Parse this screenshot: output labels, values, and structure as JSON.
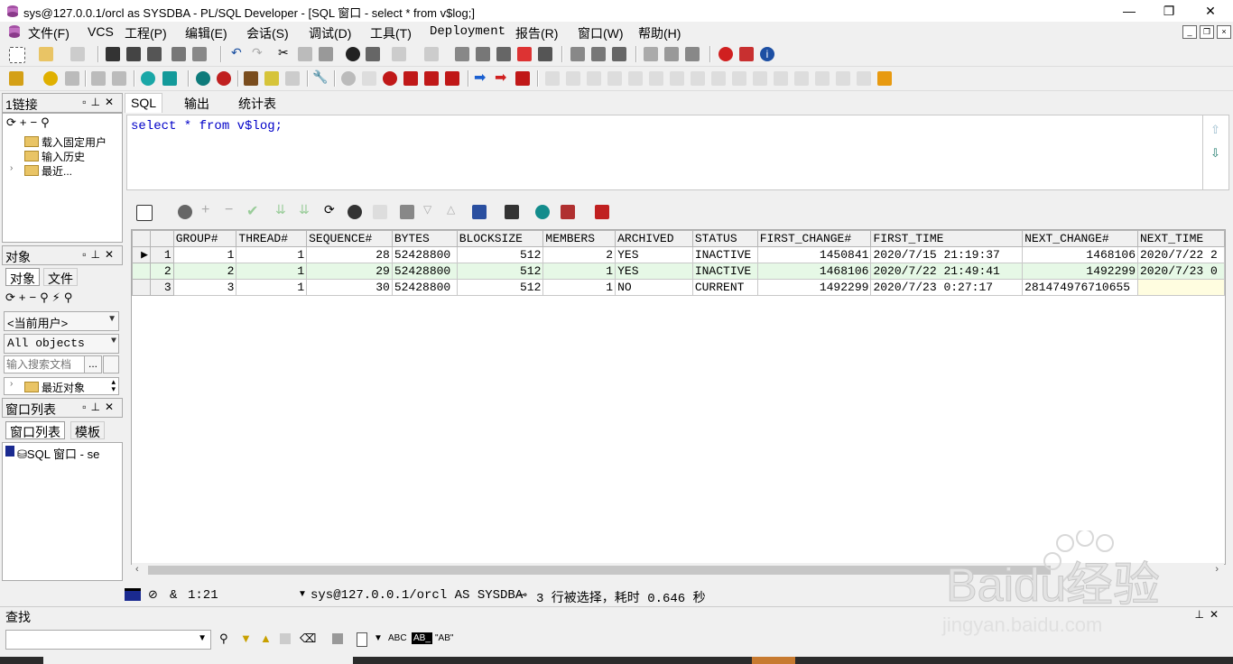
{
  "window": {
    "title": "sys@127.0.0.1/orcl as SYSDBA - PL/SQL Developer - [SQL 窗口 - select * from v$log;]",
    "min": "—",
    "max": "❐",
    "close": "✕"
  },
  "menu": [
    "文件(F)",
    "VCS",
    "工程(P)",
    "编辑(E)",
    "会话(S)",
    "调试(D)",
    "工具(T)",
    "Deployment",
    "报告(R)",
    "窗口(W)",
    "帮助(H)"
  ],
  "left": {
    "connections": {
      "title": "1链接",
      "items": [
        "载入固定用户",
        "输入历史",
        "最近..."
      ]
    },
    "objects": {
      "title": "对象",
      "tabs": [
        "对象",
        "文件"
      ],
      "user_combo": "<当前用户>",
      "objects_combo": "All objects",
      "search_placeholder": "输入搜索文档",
      "search_btn": "...",
      "recent": "最近对象"
    },
    "windows": {
      "title": "窗口列表",
      "tabs": [
        "窗口列表",
        "模板"
      ],
      "item": "SQL 窗口 - se"
    }
  },
  "sql": {
    "tabs": [
      "SQL",
      "输出",
      "统计表"
    ],
    "code": "select * from v$log;"
  },
  "grid": {
    "columns": [
      "GROUP#",
      "THREAD#",
      "SEQUENCE#",
      "BYTES",
      "BLOCKSIZE",
      "MEMBERS",
      "ARCHIVED",
      "STATUS",
      "FIRST_CHANGE#",
      "FIRST_TIME",
      "NEXT_CHANGE#",
      "NEXT_TIME"
    ],
    "rows": [
      {
        "n": "1",
        "cells": [
          "1",
          "1",
          "28",
          "52428800",
          "512",
          "2",
          "YES",
          "INACTIVE",
          "1450841",
          "2020/7/15 21:19:37",
          "1468106",
          "2020/7/22 2"
        ]
      },
      {
        "n": "2",
        "cells": [
          "2",
          "1",
          "29",
          "52428800",
          "512",
          "1",
          "YES",
          "INACTIVE",
          "1468106",
          "2020/7/22 21:49:41",
          "1492299",
          "2020/7/23 0"
        ]
      },
      {
        "n": "3",
        "cells": [
          "3",
          "1",
          "30",
          "52428800",
          "512",
          "1",
          "NO",
          "CURRENT",
          "1492299",
          "2020/7/23 0:27:17",
          "281474976710655",
          ""
        ]
      }
    ]
  },
  "status": {
    "amp": "&",
    "pos": "1:21",
    "conn": "sys@127.0.0.1/orcl AS SYSDBA",
    "msg": "3 行被选择，耗时 0.646 秒"
  },
  "find": {
    "title": "查找",
    "abc": "ABC",
    "quoted": "\"AB\""
  },
  "watermark": {
    "brand": "Baidu经验",
    "url": "jingyan.baidu.com"
  }
}
